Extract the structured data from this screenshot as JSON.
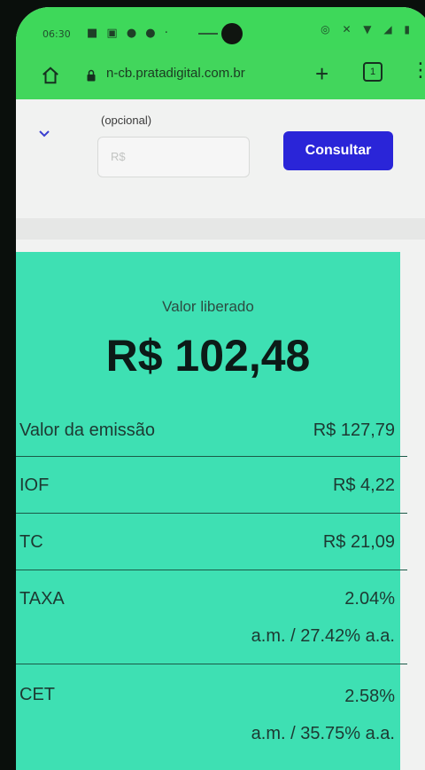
{
  "status": {
    "time": "06:30"
  },
  "browser": {
    "url": "n-cb.pratadigital.com.br",
    "tab_count": "1"
  },
  "form": {
    "optional_label": "(opcional)",
    "amount_placeholder": "R$",
    "consult_label": "Consultar"
  },
  "result": {
    "released_label": "Valor liberado",
    "released_value": "R$ 102,48",
    "rows": [
      {
        "label": "Valor da emissão",
        "value": "R$ 127,79"
      },
      {
        "label": "IOF",
        "value": "R$ 4,22"
      },
      {
        "label": "TC",
        "value": "R$ 21,09"
      },
      {
        "label": "TAXA",
        "value": "2.04%",
        "sub": "a.m.  /  27.42% a.a."
      },
      {
        "label": "CET",
        "value": "2.58%",
        "sub": "a.m.  /  35.75% a.a."
      }
    ]
  },
  "colors": {
    "browser_bar": "#42d65c",
    "card": "#3ee0b3",
    "button": "#2a25d8"
  }
}
